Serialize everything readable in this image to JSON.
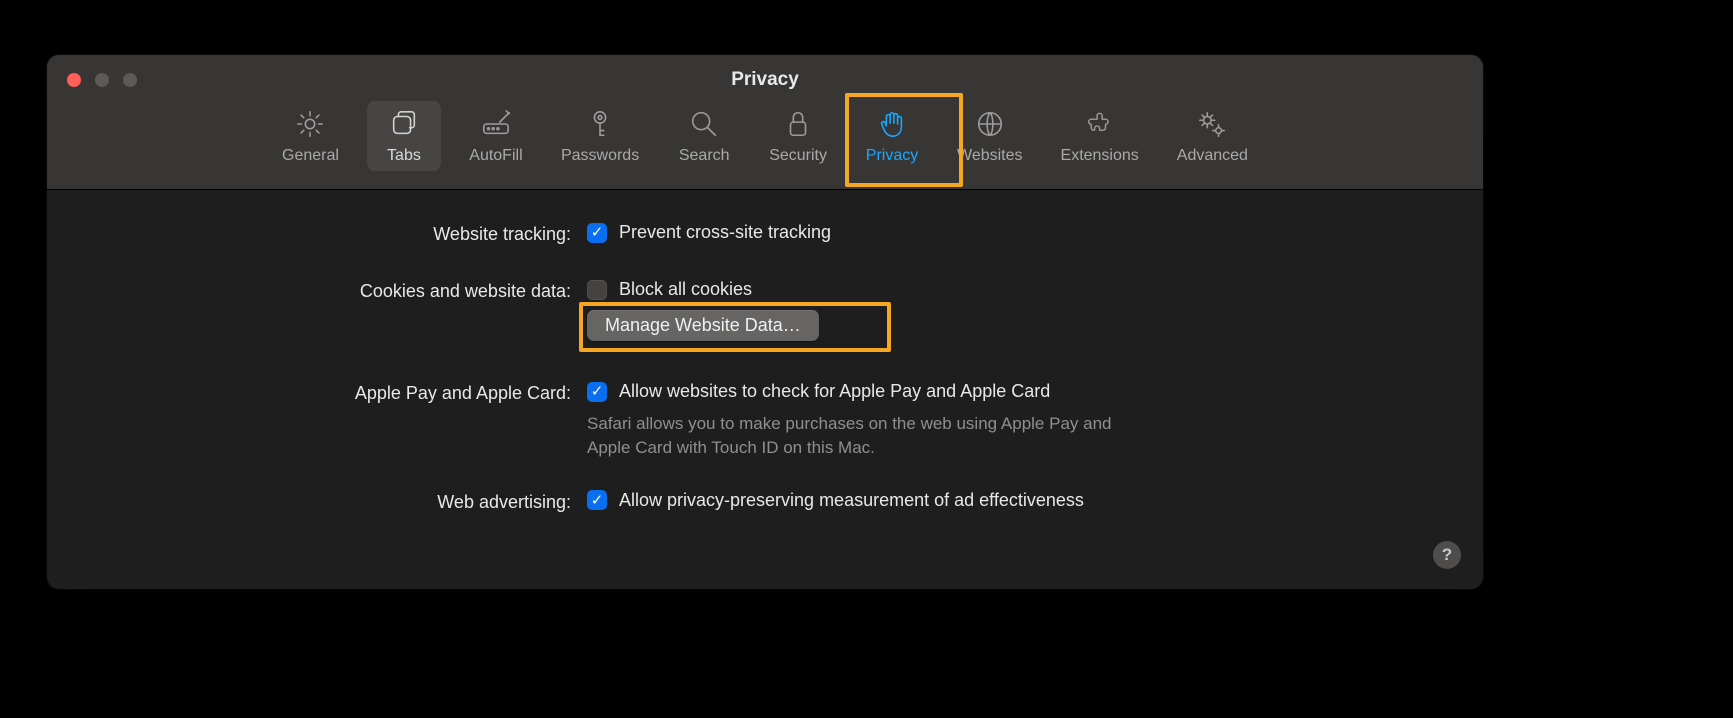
{
  "window": {
    "title": "Privacy"
  },
  "toolbar": {
    "items": [
      {
        "label": "General"
      },
      {
        "label": "Tabs"
      },
      {
        "label": "AutoFill"
      },
      {
        "label": "Passwords"
      },
      {
        "label": "Search"
      },
      {
        "label": "Security"
      },
      {
        "label": "Privacy"
      },
      {
        "label": "Websites"
      },
      {
        "label": "Extensions"
      },
      {
        "label": "Advanced"
      }
    ]
  },
  "sections": {
    "tracking": {
      "label": "Website tracking:",
      "checkbox_label": "Prevent cross-site tracking"
    },
    "cookies": {
      "label": "Cookies and website data:",
      "checkbox_label": "Block all cookies",
      "manage_button": "Manage Website Data…"
    },
    "applepay": {
      "label": "Apple Pay and Apple Card:",
      "checkbox_label": "Allow websites to check for Apple Pay and Apple Card",
      "description": "Safari allows you to make purchases on the web using Apple Pay and Apple Card with Touch ID on this Mac."
    },
    "advertising": {
      "label": "Web advertising:",
      "checkbox_label": "Allow privacy-preserving measurement of ad effectiveness"
    }
  },
  "help": {
    "label": "?"
  }
}
